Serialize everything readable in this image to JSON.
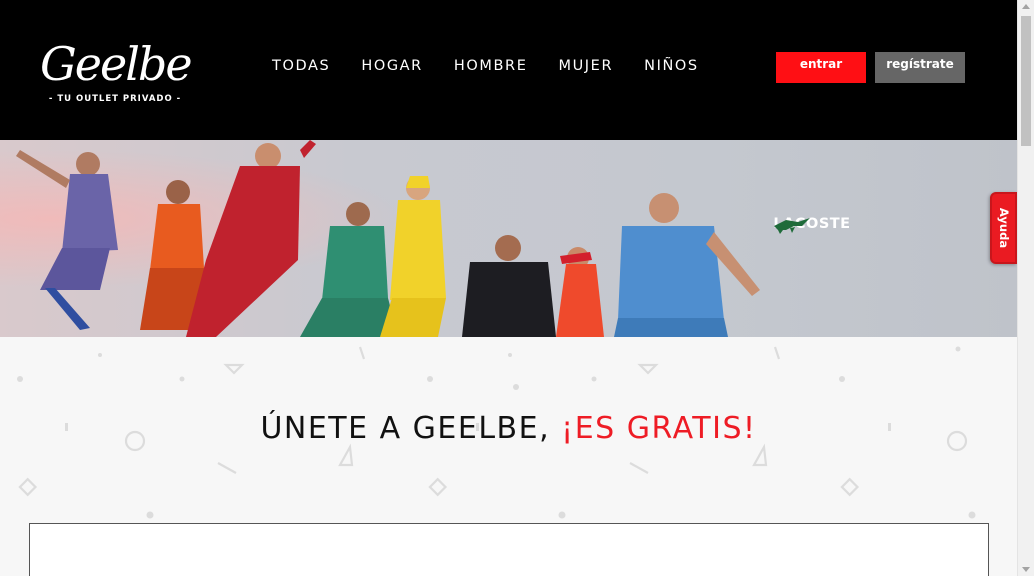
{
  "header": {
    "logo_text": "Geelbe",
    "logo_tagline": "- TU OUTLET PRIVADO -",
    "nav": [
      {
        "label": "TODAS"
      },
      {
        "label": "HOGAR"
      },
      {
        "label": "HOMBRE"
      },
      {
        "label": "MUJER"
      },
      {
        "label": "NIÑOS"
      }
    ],
    "login_label": "entrar",
    "register_label": "regístrate"
  },
  "hero": {
    "brand_logo_text": "LACOSTE",
    "brand_icon": "crocodile-icon"
  },
  "help": {
    "label": "Ayuda"
  },
  "join": {
    "title_main": "ÚNETE A GEELBE, ",
    "title_highlight": "¡ES GRATIS!"
  },
  "colors": {
    "header_bg": "#000000",
    "accent_red": "#ff0f14",
    "register_gray": "#666666",
    "page_bg": "#f7f7f7"
  }
}
